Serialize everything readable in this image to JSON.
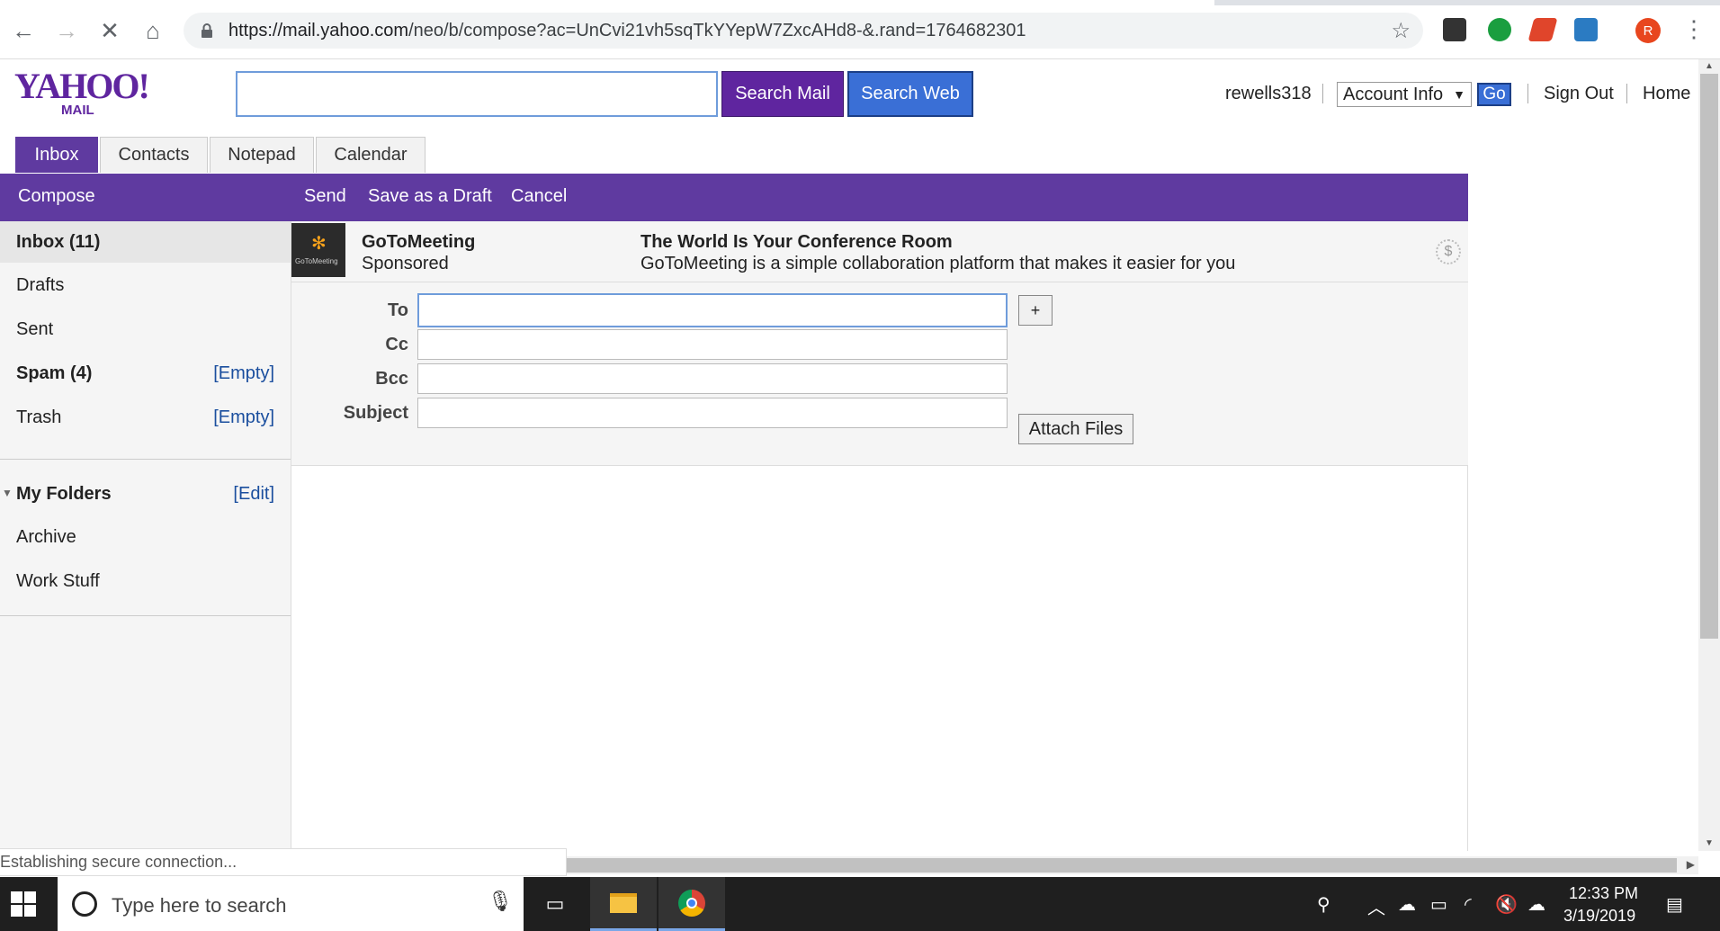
{
  "browser": {
    "url_host": "https://mail.yahoo.com",
    "url_path": "/neo/b/compose?ac=UnCvi21vh5sqTkYYepW7ZxcAHd8-&.rand=1764682301",
    "back_icon": "←",
    "forward_icon": "→",
    "reload_icon": "✕",
    "home_icon": "⌂",
    "star_icon": "☆",
    "profile_initial": "R",
    "menu_icon": "⋮"
  },
  "header": {
    "logo_text": "YAHOO!",
    "logo_sub": "MAIL",
    "search_placeholder": "",
    "search_mail_label": "Search Mail",
    "search_web_label": "Search Web",
    "username": "rewells318",
    "account_select": "Account Info",
    "go_label": "Go",
    "sign_out_label": "Sign Out",
    "home_label": "Home"
  },
  "tabs": [
    {
      "label": "Inbox"
    },
    {
      "label": "Contacts"
    },
    {
      "label": "Notepad"
    },
    {
      "label": "Calendar"
    }
  ],
  "toolbar": {
    "compose_label": "Compose",
    "send_label": "Send",
    "draft_label": "Save as a Draft",
    "cancel_label": "Cancel"
  },
  "sidebar": {
    "folders": [
      {
        "name": "Inbox (11)",
        "action": ""
      },
      {
        "name": "Drafts",
        "action": ""
      },
      {
        "name": "Sent",
        "action": ""
      },
      {
        "name": "Spam (4)",
        "action": "[Empty]"
      },
      {
        "name": "Trash",
        "action": "[Empty]"
      }
    ],
    "my_folders_label": "My Folders",
    "my_folders_edit": "[Edit]",
    "custom_folders": [
      {
        "name": "Archive"
      },
      {
        "name": "Work Stuff"
      }
    ]
  },
  "ad": {
    "name": "GoToMeeting",
    "sponsored": "Sponsored",
    "title": "The World Is Your Conference Room",
    "description": "GoToMeeting is a simple collaboration platform that makes it easier for you",
    "logo_text": "GoToMeeting",
    "badge": "$"
  },
  "compose": {
    "to_label": "To",
    "cc_label": "Cc",
    "bcc_label": "Bcc",
    "subject_label": "Subject",
    "to_value": "",
    "cc_value": "",
    "bcc_value": "",
    "subject_value": "",
    "add_label": "+",
    "attach_label": "Attach Files"
  },
  "status_bar": {
    "text": "Establishing secure connection..."
  },
  "taskbar": {
    "search_placeholder": "Type here to search",
    "time": "12:33 PM",
    "date": "3/19/2019"
  }
}
